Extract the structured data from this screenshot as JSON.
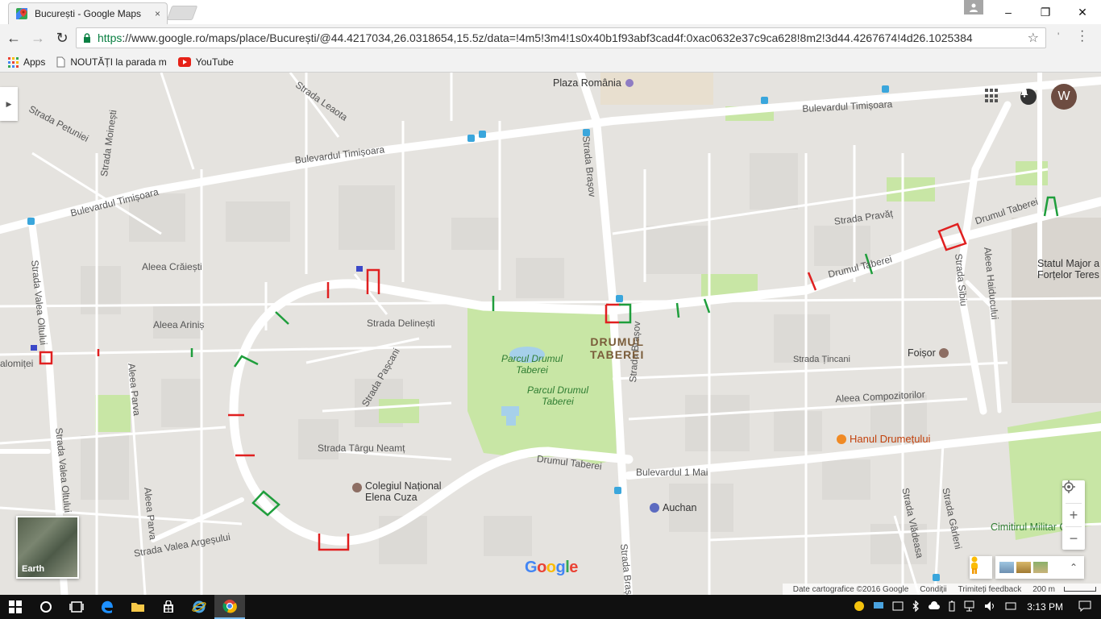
{
  "browser": {
    "tab_title": "București - Google Maps",
    "tab_close": "×",
    "url_https": "https",
    "url_rest": "://www.google.ro/maps/place/București/@44.4217034,26.0318654,15.5z/data=!4m5!3m4!1s0x40b1f93abf3cad4f:0xac0632e37c9ca628!8m2!3d44.4267674!4d26.1025384",
    "nav": {
      "back": "←",
      "forward": "→",
      "reload": "↻"
    },
    "star": "☆",
    "window": {
      "minimize": "–",
      "maximize": "❐",
      "close": "✕"
    },
    "bookmarks": [
      {
        "label": "Apps",
        "icon": "apps-grid-icon"
      },
      {
        "label": "NOUTĂȚI la parada m",
        "icon": "page-icon"
      },
      {
        "label": "YouTube",
        "icon": "youtube-icon"
      }
    ]
  },
  "map": {
    "avatar_letter": "W",
    "earth_label": "Earth",
    "logo": [
      "G",
      "o",
      "o",
      "g",
      "l",
      "e"
    ],
    "logo_colors": [
      "#4285f4",
      "#ea4335",
      "#fbbc05",
      "#4285f4",
      "#34a853",
      "#ea4335"
    ],
    "zoom_in": "+",
    "zoom_out": "−",
    "side_toggle": "▶",
    "layers_expand": "⌃",
    "footer": {
      "copyright": "Date cartografice ©2016 Google",
      "terms": "Condiții",
      "feedback": "Trimiteți feedback",
      "scale": "200 m"
    },
    "labels": {
      "plaza": "Plaza România",
      "bd_timisoara_1": "Bulevardul Timișoara",
      "bd_timisoara_2": "Bulevardul Timișoara",
      "bd_timisoara_3": "Bulevardul Timișoara",
      "strada_petuniei": "Strada Petuniei",
      "strada_moinesti": "Strada Moinești",
      "strada_leaota": "Strada Leaota",
      "strada_brasov_1": "Strada Brașov",
      "strada_brasov_2": "Strada Brașov",
      "strada_brasov_3": "Strada Brașov",
      "aleea_craiesti": "Aleea Crăiești",
      "aleea_arinis": "Aleea Ariniș",
      "strada_valea_oltului_1": "Strada Valea Oltului",
      "strada_valea_oltului_2": "Strada Valea Oltului",
      "ialomitei": "alomiței",
      "aleea_parva_1": "Aleea Parva",
      "aleea_parva_2": "Aleea Parva",
      "strada_delinesti": "Strada Delinești",
      "strada_pascani": "Strada Pașcani",
      "strada_targu_neamt": "Strada Târgu Neamț",
      "colegiul": "Colegiul Național\nElena Cuza",
      "strada_valea_argesului": "Strada Valea Argeșului",
      "parc_1": "Parcul Drumul\nTaberei",
      "parc_2": "Parcul Drumul\nTaberei",
      "drumul_taberei_area": "DRUMUL\nTABEREI",
      "drumul_taberei_road_1": "Drumul Taberei",
      "drumul_taberei_road_2": "Drumul Taberei",
      "drumul_taberei_road_3": "Drumul Taberei",
      "bd_1_mai": "Bulevardul 1 Mai",
      "auchan": "Auchan",
      "strada_pravat": "Strada Pravăț",
      "strada_sibiu": "Strada Sibiu",
      "aleea_haiducului": "Aleea Haiducului",
      "statul_major": "Statul Major a\nForțelor Teres",
      "foisor": "Foișor",
      "strada_tincani": "Strada Țincani",
      "aleea_compozitorilor": "Aleea Compozitorilor",
      "hanul": "Hanul Drumețului",
      "strada_vladeasa": "Strada Vlădeasa",
      "strada_garleni": "Strada Gârleni",
      "cimitirul": "Cimitirul Militar Ghe"
    },
    "colors": {
      "land": "#e5e3df",
      "road": "#ffffff",
      "park": "#c8e6a5",
      "block": "#dcdad6",
      "marker_red": "#e02020",
      "marker_green": "#1f9e3c",
      "water": "#a6d0ea"
    }
  },
  "taskbar": {
    "clock": "3:13 PM",
    "items": [
      "start-icon",
      "cortana-icon",
      "task-view-icon",
      "edge-icon",
      "file-explorer-icon",
      "store-icon",
      "ie-icon",
      "chrome-icon"
    ]
  }
}
